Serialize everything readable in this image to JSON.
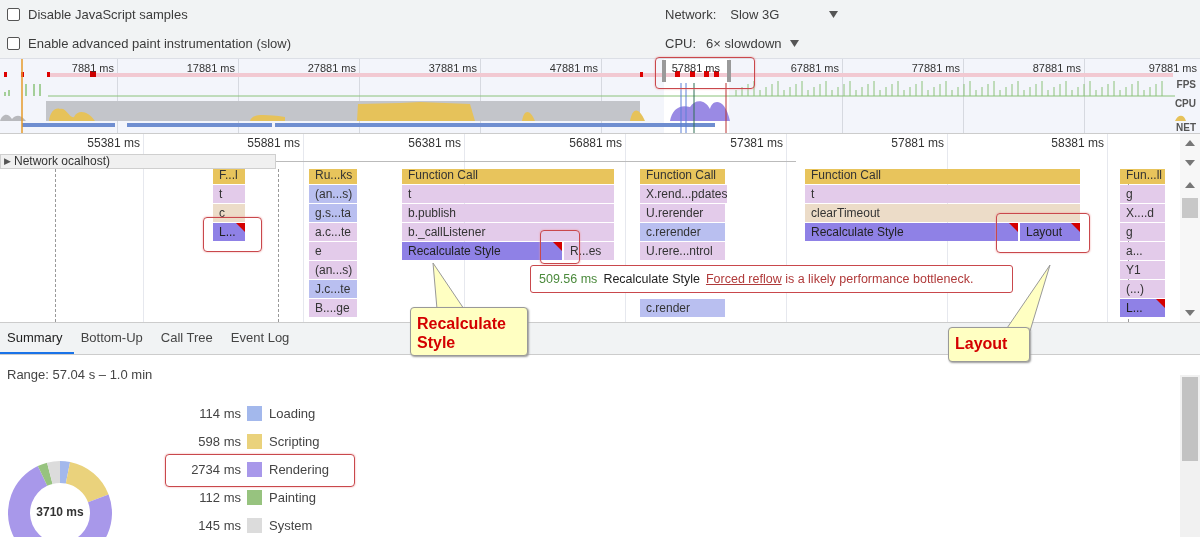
{
  "settings": {
    "checkboxes": [
      {
        "label": "Disable JavaScript samples",
        "checked": false
      },
      {
        "label": "Enable advanced paint instrumentation (slow)",
        "checked": false
      }
    ],
    "network": {
      "label": "Network:",
      "value": "Slow 3G"
    },
    "cpu": {
      "label": "CPU:",
      "value": "6× slowdown"
    }
  },
  "overview": {
    "ticks": [
      "7881 ms",
      "17881 ms",
      "27881 ms",
      "37881 ms",
      "47881 ms",
      "57881 ms",
      "67881 ms",
      "77881 ms",
      "87881 ms",
      "97881 ms"
    ],
    "lanes": [
      "FPS",
      "CPU",
      "NET"
    ]
  },
  "timeline": {
    "ticks": [
      "55381 ms",
      "55881 ms",
      "56381 ms",
      "56881 ms",
      "57381 ms",
      "57881 ms",
      "58381 ms"
    ],
    "network_track": {
      "arrow": "▶",
      "label": "Network ocalhost)",
      "expanded": false
    }
  },
  "flame_chart": {
    "columns": [
      {
        "rows": [
          [
            {
              "label": "F...l",
              "kind": "call",
              "warning": false
            }
          ],
          [
            {
              "label": "t",
              "kind": "script",
              "warning": false
            }
          ],
          [
            {
              "label": "c",
              "kind": "timer",
              "warning": false
            }
          ],
          [
            {
              "label": "L...",
              "kind": "rendering",
              "warning": true
            }
          ]
        ]
      },
      {
        "rows": [
          [
            {
              "label": "Ru...ks",
              "kind": "call",
              "warning": false
            }
          ],
          [
            {
              "label": "(an...s)",
              "kind": "script-alt",
              "warning": false
            }
          ],
          [
            {
              "label": "g.s...ta",
              "kind": "script-alt",
              "warning": false
            }
          ],
          [
            {
              "label": "a.c...te",
              "kind": "script",
              "warning": false
            }
          ],
          [
            {
              "label": "e",
              "kind": "script",
              "warning": false
            }
          ],
          [
            {
              "label": "(an...s)",
              "kind": "script",
              "warning": false
            }
          ],
          [
            {
              "label": "J.c...te",
              "kind": "script-alt",
              "warning": false
            }
          ],
          [
            {
              "label": "B....ge",
              "kind": "script",
              "warning": false
            }
          ]
        ]
      },
      {
        "rows": [
          [
            {
              "label": "Function Call",
              "kind": "call",
              "warning": false
            }
          ],
          [
            {
              "label": "t",
              "kind": "script",
              "warning": false
            }
          ],
          [
            {
              "label": "b.publish",
              "kind": "script",
              "warning": false
            }
          ],
          [
            {
              "label": "b._callListener",
              "kind": "script",
              "warning": false
            }
          ],
          [
            {
              "label": "Recalculate Style",
              "kind": "rendering",
              "warning": true
            },
            {
              "label": "R...es",
              "kind": "script",
              "warning": false
            }
          ]
        ]
      },
      {
        "rows": [
          [
            {
              "label": "Function Call",
              "kind": "call",
              "warning": false
            }
          ],
          [
            {
              "label": "X.rend...pdates",
              "kind": "script",
              "warning": false
            }
          ],
          [
            {
              "label": "U.rerender",
              "kind": "script",
              "warning": false
            }
          ],
          [
            {
              "label": "c.rerender",
              "kind": "script-alt",
              "warning": false
            }
          ],
          [
            {
              "label": "U.rere...ntrol",
              "kind": "script",
              "warning": false
            }
          ],
          [
            {
              "label": "c.render",
              "kind": "script-alt",
              "warning": false
            }
          ]
        ]
      },
      {
        "rows": [
          [
            {
              "label": "Function Call",
              "kind": "call",
              "warning": false
            }
          ],
          [
            {
              "label": "t",
              "kind": "script",
              "warning": false
            }
          ],
          [
            {
              "label": "clearTimeout",
              "kind": "timer",
              "warning": false
            }
          ],
          [
            {
              "label": "Recalculate Style",
              "kind": "rendering",
              "warning": true
            },
            {
              "label": "Layout",
              "kind": "rendering",
              "warning": true
            }
          ]
        ]
      },
      {
        "rows": [
          [
            {
              "label": "Fun...ll",
              "kind": "call",
              "warning": false
            }
          ],
          [
            {
              "label": "g",
              "kind": "script",
              "warning": false
            }
          ],
          [
            {
              "label": "X....d",
              "kind": "script",
              "warning": false
            }
          ],
          [
            {
              "label": "g",
              "kind": "script",
              "warning": false
            }
          ],
          [
            {
              "label": "a...",
              "kind": "script",
              "warning": false
            }
          ],
          [
            {
              "label": "Y1",
              "kind": "script",
              "warning": false
            }
          ],
          [
            {
              "label": "(...)",
              "kind": "script",
              "warning": false
            }
          ],
          [
            {
              "label": "L...",
              "kind": "rendering",
              "warning": true
            }
          ]
        ]
      }
    ]
  },
  "tooltip": {
    "duration": "509.56 ms",
    "title": "Recalculate Style",
    "link": "Forced reflow",
    "message": "is a likely performance bottleneck."
  },
  "annotations": [
    {
      "text": "Recalculate Style"
    },
    {
      "text": "Layout"
    }
  ],
  "tabs": [
    {
      "label": "Summary",
      "selected": true
    },
    {
      "label": "Bottom-Up",
      "selected": false
    },
    {
      "label": "Call Tree",
      "selected": false
    },
    {
      "label": "Event Log",
      "selected": false
    }
  ],
  "summary": {
    "range": "Range: 57.04 s – 1.0 min",
    "total": "3710 ms",
    "categories": [
      {
        "value": "114 ms",
        "color": "#a3b8ec"
      },
      {
        "value": "598 ms",
        "color": "#ead27c"
      },
      {
        "value": "2734 ms",
        "color": "#a898ea"
      },
      {
        "value": "112 ms",
        "color": "#97c37f"
      },
      {
        "value": "145 ms",
        "color": "#dcdcdc"
      }
    ],
    "chart_data": {
      "type": "donut",
      "categories": [
        "Loading",
        "Scripting",
        "Rendering",
        "Painting",
        "System"
      ],
      "values": [
        3.1,
        16.1,
        73.8,
        3.0,
        4.0
      ]
    }
  }
}
